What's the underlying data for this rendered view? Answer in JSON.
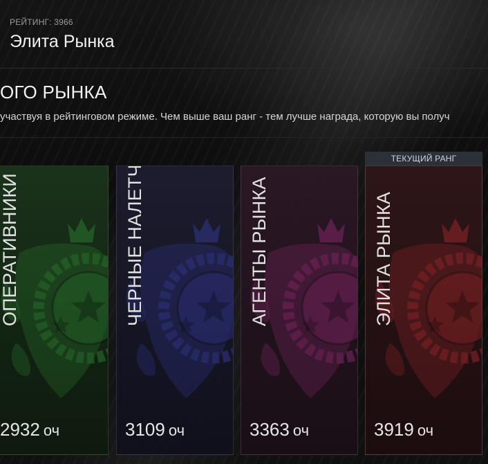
{
  "header": {
    "rating_line": "РЕЙТИНГ: 3966",
    "rank_name": "Элита Рынка"
  },
  "section": {
    "title": "ОГО РЫНКА",
    "description": "участвуя в рейтинговом режиме. Чем выше ваш ранг - тем лучше награда, которую вы получ"
  },
  "current_rank_badge": "ТЕКУЩИЙ РАНГ",
  "ranks": [
    {
      "name": "ОПЕРАТИВНИКИ",
      "points": "2932",
      "unit": "оч",
      "color": "#2f8a34"
    },
    {
      "name": "ЧЕРНЫЕ НАЛЕТЧИКИ",
      "points": "3109",
      "unit": "оч",
      "color": "#3a3fa8"
    },
    {
      "name": "АГЕНТЫ РЫНКА",
      "points": "3363",
      "unit": "оч",
      "color": "#9a2a78"
    },
    {
      "name": "ЭЛИТА РЫНКА",
      "points": "3919",
      "unit": "оч",
      "color": "#b02a30"
    }
  ]
}
